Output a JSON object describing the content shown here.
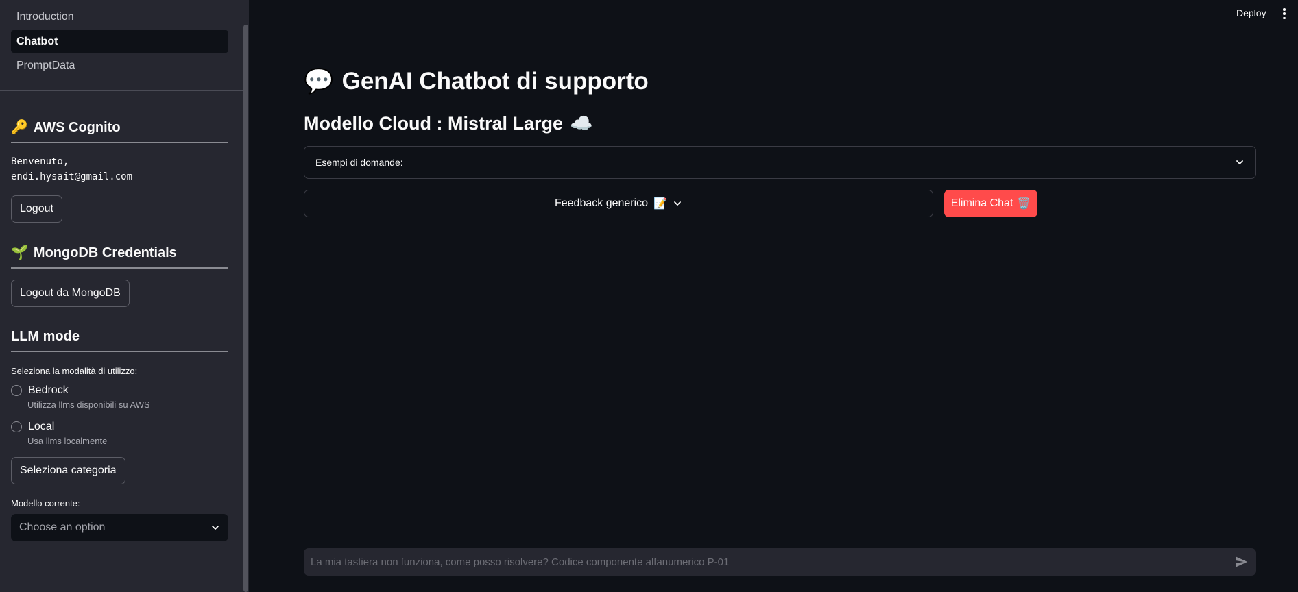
{
  "sidebar": {
    "nav": [
      {
        "label": "Introduction",
        "active": false
      },
      {
        "label": "Chatbot",
        "active": true
      },
      {
        "label": "PromptData",
        "active": false
      }
    ],
    "aws": {
      "emoji": "🔑",
      "title": "AWS Cognito",
      "welcome_line1": "Benvenuto,",
      "welcome_line2": "endi.hysait@gmail.com",
      "logout_label": "Logout"
    },
    "mongo": {
      "emoji": "🌱",
      "title": "MongoDB Credentials",
      "logout_label": "Logout da MongoDB"
    },
    "llm": {
      "title": "LLM mode",
      "radio_label": "Seleziona la modalità di utilizzo:",
      "options": [
        {
          "label": "Bedrock",
          "help": "Utilizza llms disponibili su AWS",
          "selected": false
        },
        {
          "label": "Local",
          "help": "Usa llms localmente",
          "selected": false
        }
      ],
      "category_button": "Seleziona categoria",
      "model_label": "Modello corrente:",
      "model_placeholder": "Choose an option"
    }
  },
  "topbar": {
    "deploy_label": "Deploy",
    "menu_icon": "kebab-menu-icon"
  },
  "main": {
    "title_emoji": "💬",
    "title": "GenAI Chatbot di supporto",
    "subtitle": "Modello Cloud : Mistral Large",
    "subtitle_emoji": "☁️",
    "expander_label": "Esempi di domande:",
    "feedback_label": "Feedback generico",
    "feedback_emoji": "📝",
    "delete_label": "Elimina Chat",
    "delete_emoji": "🗑️",
    "chat_placeholder": "La mia tastiera non funziona, come posso risolvere? Codice componente alfanumerico P-01"
  },
  "colors": {
    "background": "#0e1117",
    "sidebar": "#262730",
    "primary": "#ff4b4b"
  }
}
